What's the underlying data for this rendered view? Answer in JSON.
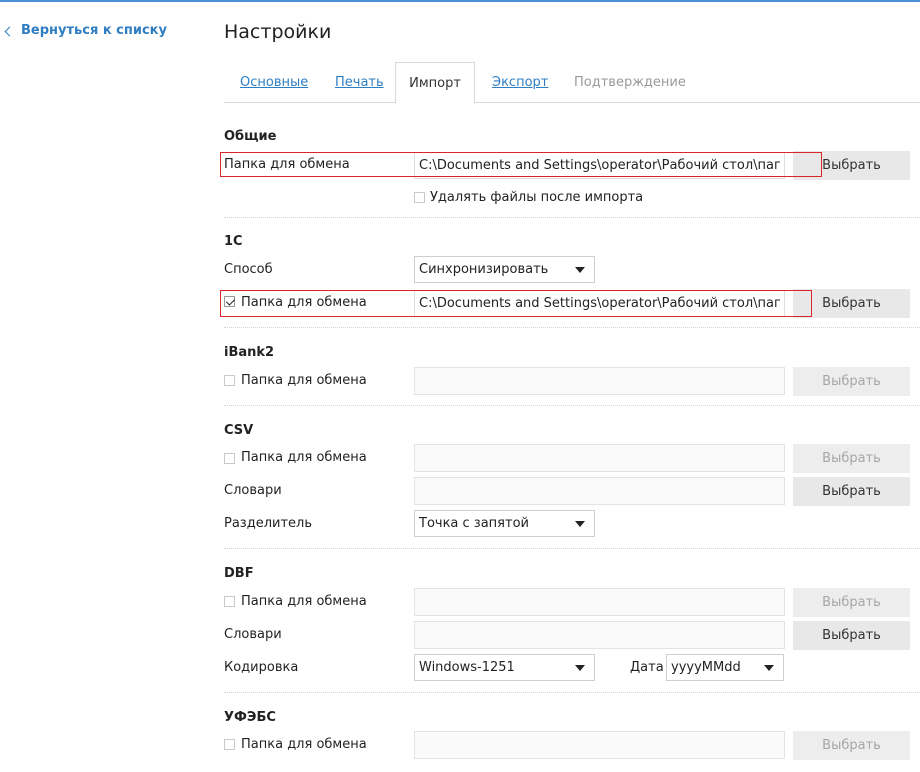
{
  "nav": {
    "back_label": "Вернуться к списку"
  },
  "page": {
    "title": "Настройки"
  },
  "tabs": [
    {
      "label": "Основные",
      "state": "link"
    },
    {
      "label": "Печать",
      "state": "link"
    },
    {
      "label": "Импорт",
      "state": "active"
    },
    {
      "label": "Экспорт",
      "state": "link"
    },
    {
      "label": "Подтверждение",
      "state": "disabled"
    }
  ],
  "common": {
    "title": "Общие",
    "folder_label": "Папка для обмена",
    "folder_value": "C:\\Documents and Settings\\operator\\Рабочий стол\\папка обмена",
    "choose_label": "Выбрать",
    "delete_checked": false,
    "delete_label": "Удалять файлы после импорта"
  },
  "onec": {
    "title": "1С",
    "method_label": "Способ",
    "method_value": "Синхронизировать",
    "folder_checked": true,
    "folder_label": "Папка для обмена",
    "folder_value": "C:\\Documents and Settings\\operator\\Рабочий стол\\папка обмена",
    "choose_label": "Выбрать"
  },
  "ibank2": {
    "title": "iBank2",
    "folder_checked": false,
    "folder_label": "Папка для обмена",
    "folder_value": "",
    "choose_label": "Выбрать"
  },
  "csv": {
    "title": "CSV",
    "folder_checked": false,
    "folder_label": "Папка для обмена",
    "folder_value": "",
    "choose_folder_label": "Выбрать",
    "dict_label": "Словари",
    "dict_value": "",
    "choose_dict_label": "Выбрать",
    "sep_label": "Разделитель",
    "sep_value": "Точка с запятой"
  },
  "dbf": {
    "title": "DBF",
    "folder_checked": false,
    "folder_label": "Папка для обмена",
    "folder_value": "",
    "choose_folder_label": "Выбрать",
    "dict_label": "Словари",
    "dict_value": "",
    "choose_dict_label": "Выбрать",
    "enc_label": "Кодировка",
    "enc_value": "Windows-1251",
    "date_label": "Дата",
    "date_value": "yyyyMMdd"
  },
  "ufebs": {
    "title": "УФЭБС",
    "folder_checked": false,
    "folder_label": "Папка для обмена",
    "folder_value": "",
    "choose_label": "Выбрать"
  },
  "colors": {
    "link": "#2f7ec1",
    "highlight": "#d9262a",
    "button": "#e8e8e8",
    "button_disabled_text": "#a6a6a6"
  }
}
